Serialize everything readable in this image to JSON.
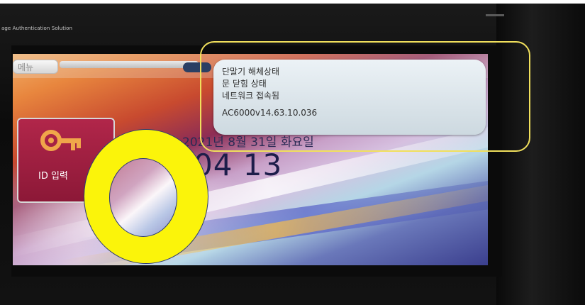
{
  "device": {
    "header_text": "age Authentication Solution",
    "colors": {
      "highlight": "#f1e05c",
      "ring": "#fbf40a",
      "panel": "#e3ebf0"
    }
  },
  "screen": {
    "menu_label": "메뉴",
    "id_tile_label": "ID 입력",
    "date": "2021년 8월 31일 화요일",
    "time": "04 13",
    "icons": [
      "key-icon",
      "clock-icon"
    ]
  },
  "status": {
    "line1": "단말기 해체상태",
    "line2": "문 닫힘 상태",
    "line3": "네트워크 접속됨",
    "version": "AC6000v14.63.10.036"
  }
}
